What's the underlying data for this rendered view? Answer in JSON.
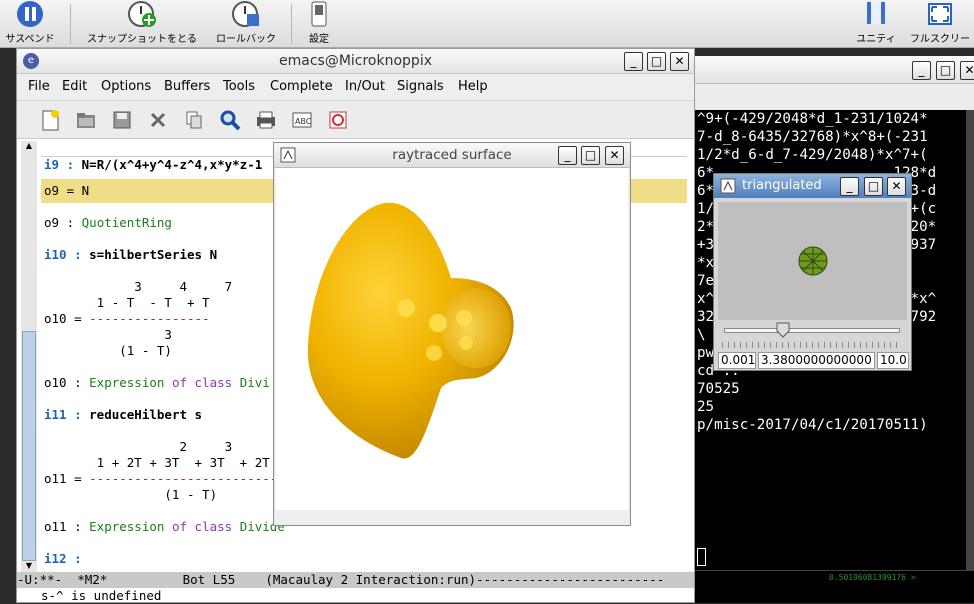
{
  "host_toolbar": {
    "suspend": "サスペンド",
    "snapshot": "スナップショットをとる",
    "rollback": "ロールバック",
    "settings": "設定",
    "unity": "ユニティ",
    "fullscreen": "フルスクリー"
  },
  "emacs": {
    "title": "emacs@Microknoppix",
    "menu": [
      "File",
      "Edit",
      "Options",
      "Buffers",
      "Tools",
      "Complete",
      "In/Out",
      "Signals",
      "Help"
    ],
    "lines": {
      "l1_pre": "i9 : ",
      "l1_code": "N=R/(x^4+y^4-z^4,x*y*z-1",
      "l2": "o9 = N",
      "l3_pre": "o9 : ",
      "l3_val": "QuotientRing",
      "l4_pre": "i10 : ",
      "l4_code": "s=hilbertSeries N",
      "l5": "            3     4     7",
      "l6": "       1 - T  - T  + T",
      "l7_pre": "o10 = ",
      "l7_line": "----------------",
      "l8": "                3",
      "l9": "          (1 - T)",
      "l10_pre": "o10 : ",
      "l10_a": "Expression",
      "l10_of": " of ",
      "l10_class": "class",
      "l10_b": " Divi",
      "l11_pre": "i11 : ",
      "l11_code": "reduceHilbert s",
      "l12": "                  2     3",
      "l13": "       1 + 2T + 3T  + 3T  + 2T",
      "l14_pre": "o11 = ",
      "l14_line": "----------------------------",
      "l15": "                (1 - T)",
      "l16_pre": "o11 : ",
      "l16_a": "Expression",
      "l16_of": " of ",
      "l16_class": "class",
      "l16_b": " Divide",
      "l17": "i12 : "
    },
    "modeline": "-U:**-  *M2*          Bot L55    (Macaulay 2 Interaction:run)-------------------------",
    "minibuffer": "s-^ is undefined"
  },
  "raytraced": {
    "title": "raytraced surface"
  },
  "triangulated": {
    "title": "triangulated",
    "min_value": "0.001",
    "current_value": "3.3800000000000",
    "max_value": "10.0",
    "slider_fraction": 0.338
  },
  "terminal": {
    "lines": [
      "^9+(-429/2048*d_1-231/1024*",
      "7-d_8-6435/32768)*x^8+(-231",
      "1/2*d_6-d_7-429/2048)*x^7+(",
      "6*                     128*d",
      "6*                     d_3-d",
      "1/                     ^2+(c",
      "",
      "2*                     1120*",
      "+3                     17937",
      "*x                     )",
      "7e",
      "x^                     20*x^",
      "32                     93792",
      "\\                          ",
      "",
      "",
      "pwd",
      "",
      "cd ..",
      "70525",
      "25",
      "p/misc-2017/04/c1/20170511)"
    ],
    "status": "0.50196081399176 >"
  },
  "colors": {
    "highlight": "#f0dd88",
    "surface": "#e8b000"
  }
}
